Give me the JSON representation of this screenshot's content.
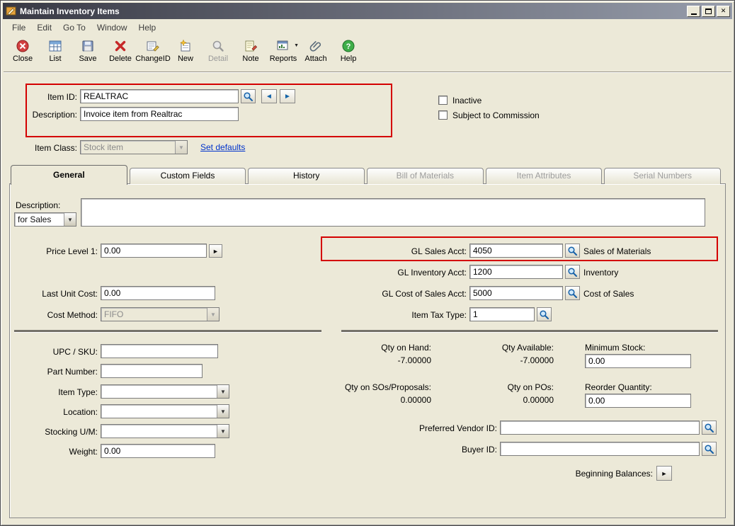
{
  "window": {
    "title": "Maintain Inventory Items"
  },
  "menu": [
    "File",
    "Edit",
    "Go To",
    "Window",
    "Help"
  ],
  "toolbar": [
    {
      "label": "Close"
    },
    {
      "label": "List"
    },
    {
      "label": "Save"
    },
    {
      "label": "Delete"
    },
    {
      "label": "ChangeID"
    },
    {
      "label": "New"
    },
    {
      "label": "Detail"
    },
    {
      "label": "Note"
    },
    {
      "label": "Reports"
    },
    {
      "label": "Attach"
    },
    {
      "label": "Help"
    }
  ],
  "header": {
    "item_id_label": "Item ID:",
    "item_id": "REALTRAC",
    "description_label": "Description:",
    "description": "Invoice item from Realtrac",
    "item_class_label": "Item Class:",
    "item_class": "Stock item",
    "set_defaults": "Set defaults",
    "inactive": "Inactive",
    "commission": "Subject to Commission"
  },
  "tabs": [
    "General",
    "Custom Fields",
    "History",
    "Bill of Materials",
    "Item Attributes",
    "Serial Numbers"
  ],
  "general": {
    "description_label": "Description:",
    "description_for": "for Sales",
    "description_text": "",
    "price_level_label": "Price Level 1:",
    "price_level": "0.00",
    "last_unit_cost_label": "Last Unit Cost:",
    "last_unit_cost": "0.00",
    "cost_method_label": "Cost Method:",
    "cost_method": "FIFO",
    "gl_sales_label": "GL Sales Acct:",
    "gl_sales": "4050",
    "gl_sales_name": "Sales of Materials",
    "gl_inventory_label": "GL Inventory Acct:",
    "gl_inventory": "1200",
    "gl_inventory_name": "Inventory",
    "gl_cos_label": "GL Cost of Sales Acct:",
    "gl_cos": "5000",
    "gl_cos_name": "Cost of Sales",
    "item_tax_label": "Item Tax Type:",
    "item_tax": "1",
    "upc_label": "UPC / SKU:",
    "upc": "",
    "part_label": "Part Number:",
    "part": "",
    "item_type_label": "Item Type:",
    "item_type": "",
    "location_label": "Location:",
    "location": "",
    "stocking_label": "Stocking U/M:",
    "stocking": "",
    "weight_label": "Weight:",
    "weight": "0.00",
    "qty_hand_label": "Qty on Hand:",
    "qty_hand": "-7.00000",
    "qty_avail_label": "Qty Available:",
    "qty_avail": "-7.00000",
    "min_stock_label": "Minimum Stock:",
    "min_stock": "0.00",
    "qty_sos_label": "Qty on SOs/Proposals:",
    "qty_sos": "0.00000",
    "qty_pos_label": "Qty on POs:",
    "qty_pos": "0.00000",
    "reorder_label": "Reorder Quantity:",
    "reorder": "0.00",
    "vendor_label": "Preferred Vendor ID:",
    "vendor": "",
    "buyer_label": "Buyer ID:",
    "buyer": "",
    "beginning_label": "Beginning Balances:"
  },
  "colors": {
    "annotation": "#d40000",
    "link": "#0033cc"
  }
}
